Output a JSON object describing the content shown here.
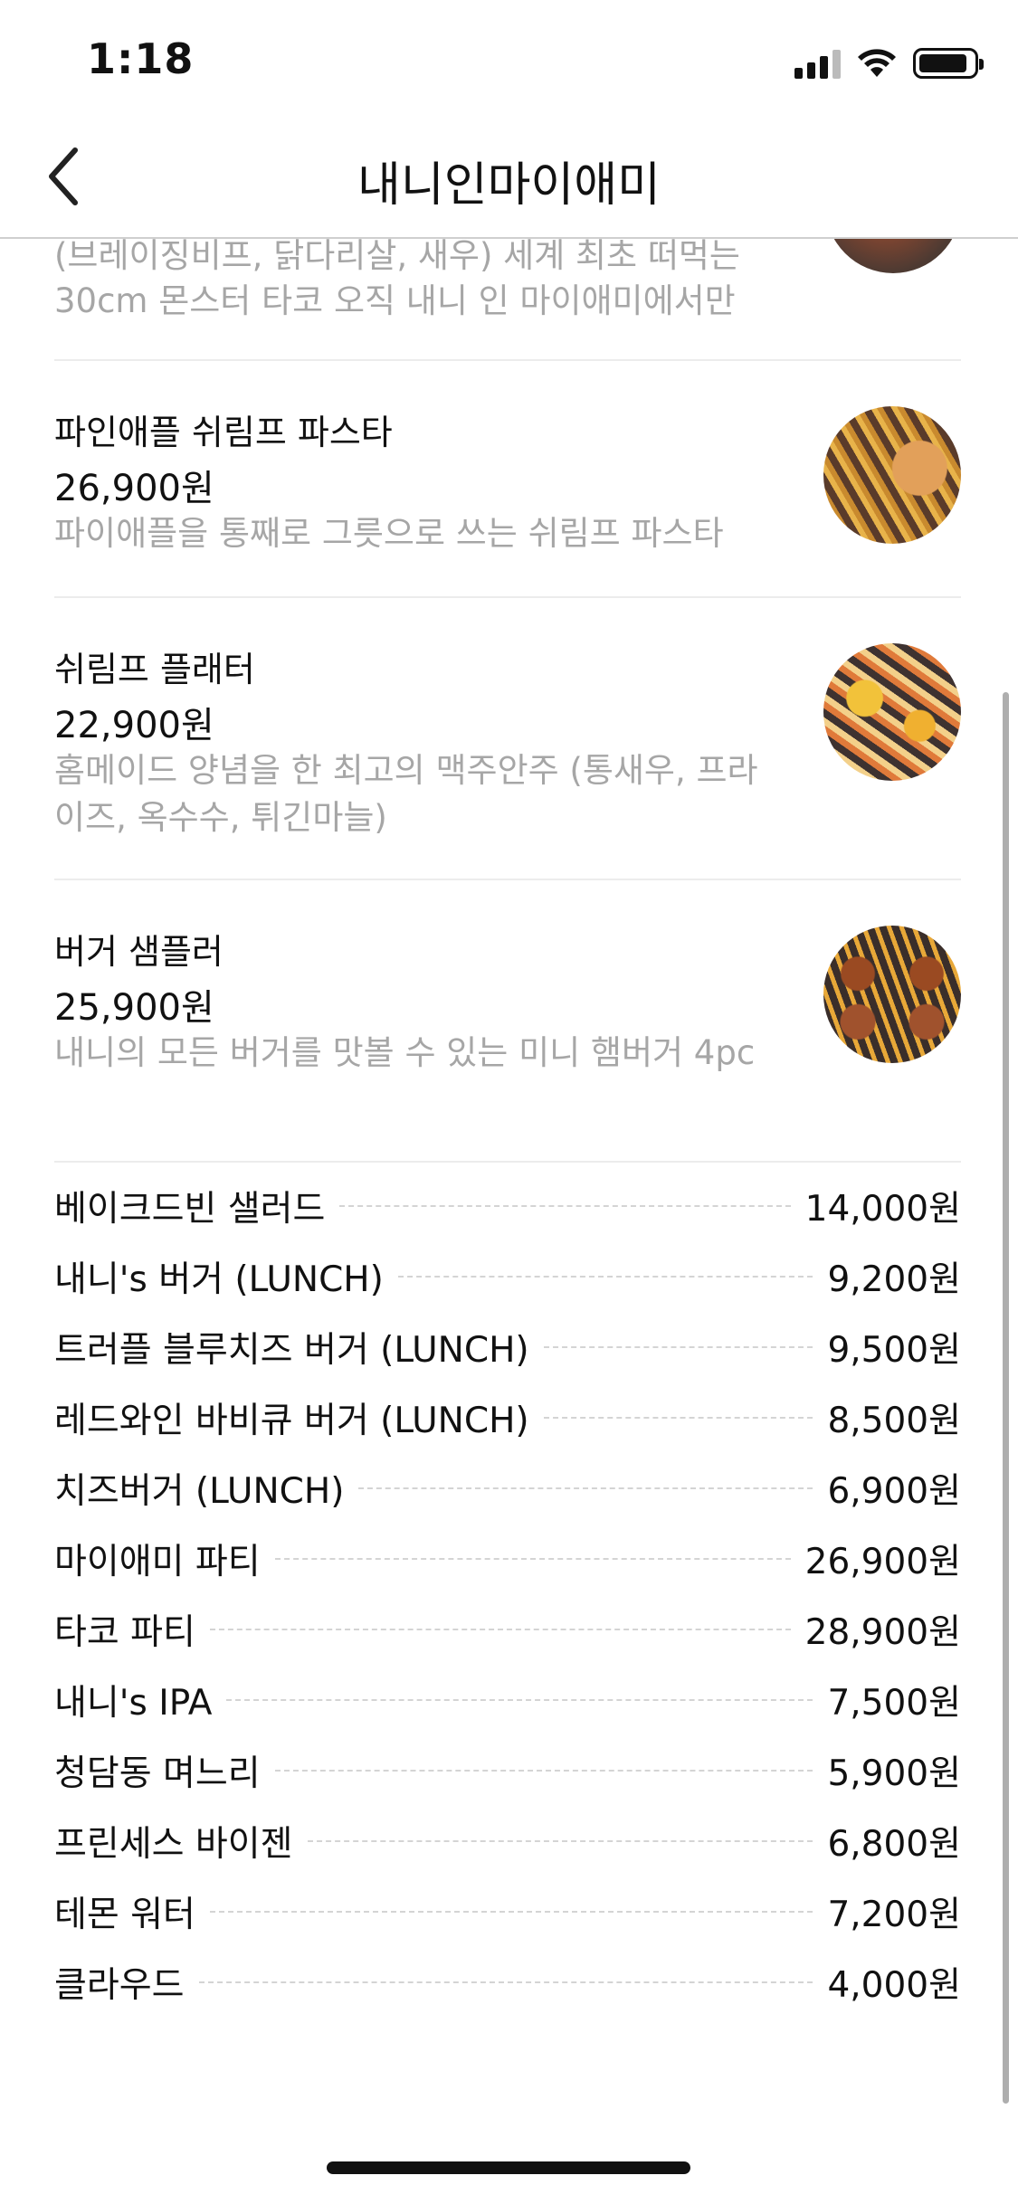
{
  "status_bar": {
    "time": "1:18",
    "icons": [
      "cellular-signal-icon",
      "wifi-icon",
      "battery-icon"
    ],
    "battery_level": 0.9
  },
  "nav": {
    "back_icon": "chevron-left-icon",
    "title": "내니인마이애미"
  },
  "partial_item": {
    "description": "(브레이징비프, 닭다리살, 새우) 세계 최초 떠먹는 30cm 몬스터 타코 오직 내니 인 마이애미에서만"
  },
  "menu_items": [
    {
      "name": "파인애플 쉬림프 파스타",
      "price": "26,900원",
      "description": "파이애플을 통째로 그릇으로 쓰는 쉬림프 파스타"
    },
    {
      "name": "쉬림프 플래터",
      "price": "22,900원",
      "description": "홈메이드 양념을 한 최고의 맥주안주 (통새우, 프라이즈, 옥수수, 튀긴마늘)"
    },
    {
      "name": "버거 샘플러",
      "price": "25,900원",
      "description": "내니의 모든 버거를 맛볼 수 있는 미니 햄버거 4pc"
    }
  ],
  "price_list": [
    {
      "name": "베이크드빈 샐러드",
      "price": "14,000원"
    },
    {
      "name": "내니's 버거 (LUNCH)",
      "price": "9,200원"
    },
    {
      "name": "트러플 블루치즈 버거 (LUNCH)",
      "price": "9,500원"
    },
    {
      "name": "레드와인 바비큐 버거 (LUNCH)",
      "price": "8,500원"
    },
    {
      "name": "치즈버거 (LUNCH)",
      "price": "6,900원"
    },
    {
      "name": "마이애미 파티",
      "price": "26,900원"
    },
    {
      "name": "타코 파티",
      "price": "28,900원"
    },
    {
      "name": "내니's IPA",
      "price": "7,500원"
    },
    {
      "name": "청담동 며느리",
      "price": "5,900원"
    },
    {
      "name": "프린세스 바이젠",
      "price": "6,800원"
    },
    {
      "name": "테몬 워터",
      "price": "7,200원"
    },
    {
      "name": "클라우드",
      "price": "4,000원"
    }
  ]
}
